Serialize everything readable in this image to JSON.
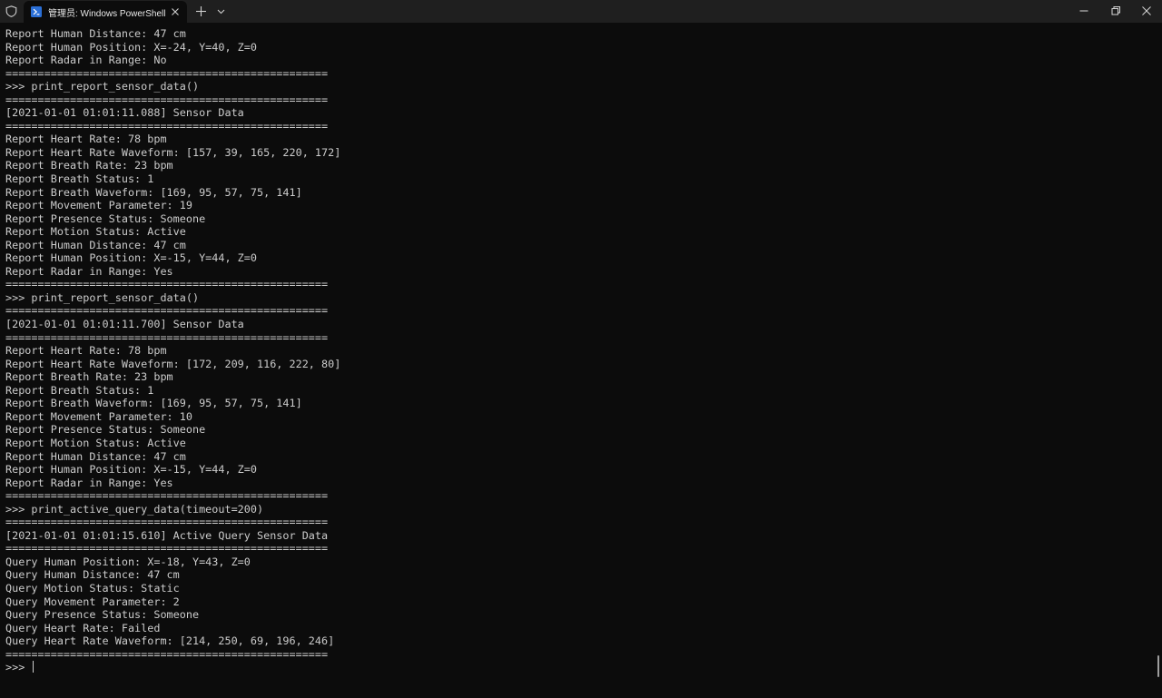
{
  "window": {
    "tab_title": "管理员: Windows PowerShell",
    "tab_icon": "powershell-icon",
    "accent": "#012456"
  },
  "terminal": {
    "lines": [
      "Report Human Distance: 47 cm",
      "Report Human Position: X=-24, Y=40, Z=0",
      "Report Radar in Range: No",
      "==================================================",
      ">>> print_report_sensor_data()",
      "==================================================",
      "[2021-01-01 01:01:11.088] Sensor Data",
      "==================================================",
      "Report Heart Rate: 78 bpm",
      "Report Heart Rate Waveform: [157, 39, 165, 220, 172]",
      "Report Breath Rate: 23 bpm",
      "Report Breath Status: 1",
      "Report Breath Waveform: [169, 95, 57, 75, 141]",
      "Report Movement Parameter: 19",
      "Report Presence Status: Someone",
      "Report Motion Status: Active",
      "Report Human Distance: 47 cm",
      "Report Human Position: X=-15, Y=44, Z=0",
      "Report Radar in Range: Yes",
      "==================================================",
      ">>> print_report_sensor_data()",
      "==================================================",
      "[2021-01-01 01:01:11.700] Sensor Data",
      "==================================================",
      "Report Heart Rate: 78 bpm",
      "Report Heart Rate Waveform: [172, 209, 116, 222, 80]",
      "Report Breath Rate: 23 bpm",
      "Report Breath Status: 1",
      "Report Breath Waveform: [169, 95, 57, 75, 141]",
      "Report Movement Parameter: 10",
      "Report Presence Status: Someone",
      "Report Motion Status: Active",
      "Report Human Distance: 47 cm",
      "Report Human Position: X=-15, Y=44, Z=0",
      "Report Radar in Range: Yes",
      "==================================================",
      ">>> print_active_query_data(timeout=200)",
      "==================================================",
      "[2021-01-01 01:01:15.610] Active Query Sensor Data",
      "==================================================",
      "Query Human Position: X=-18, Y=43, Z=0",
      "Query Human Distance: 47 cm",
      "Query Motion Status: Static",
      "Query Movement Parameter: 2",
      "Query Presence Status: Someone",
      "Query Heart Rate: Failed",
      "Query Heart Rate Waveform: [214, 250, 69, 196, 246]",
      "=================================================="
    ],
    "prompt": ">>> ",
    "colors": {
      "background": "#0c0c0c",
      "foreground": "#cccccc"
    }
  }
}
